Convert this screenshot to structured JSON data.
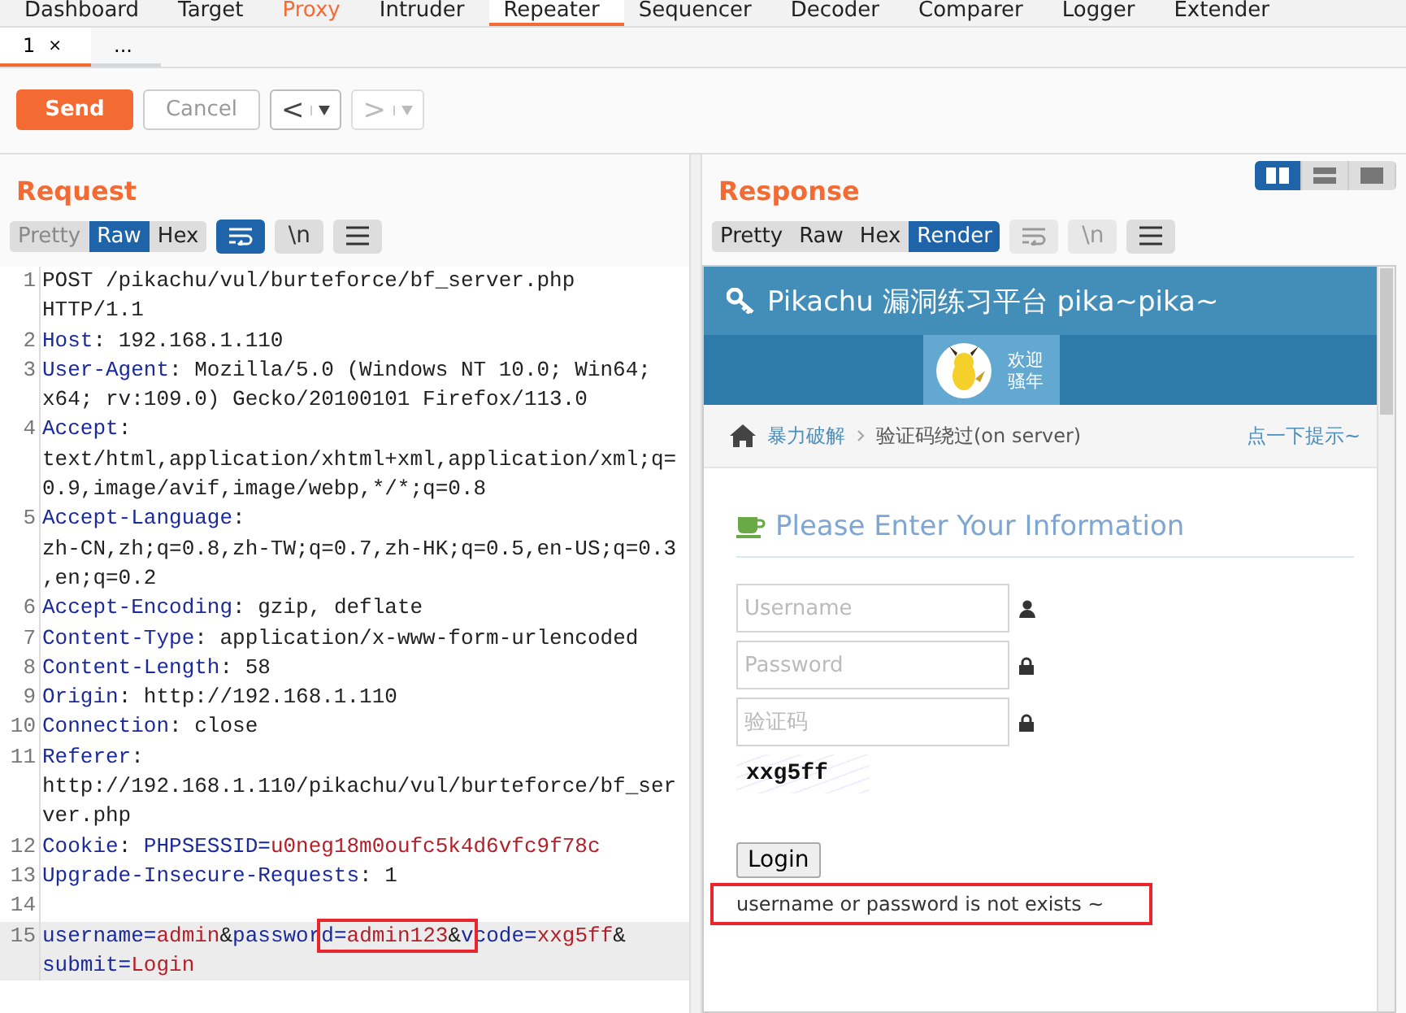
{
  "main_tabs": [
    {
      "label": "Dashboard",
      "selected": false,
      "alert": false
    },
    {
      "label": "Target",
      "selected": false,
      "alert": false
    },
    {
      "label": "Proxy",
      "selected": false,
      "alert": true
    },
    {
      "label": "Intruder",
      "selected": false,
      "alert": false
    },
    {
      "label": "Repeater",
      "selected": true,
      "alert": false
    },
    {
      "label": "Sequencer",
      "selected": false,
      "alert": false
    },
    {
      "label": "Decoder",
      "selected": false,
      "alert": false
    },
    {
      "label": "Comparer",
      "selected": false,
      "alert": false
    },
    {
      "label": "Logger",
      "selected": false,
      "alert": false
    },
    {
      "label": "Extender",
      "selected": false,
      "alert": false
    }
  ],
  "sub_tabs": [
    {
      "label": "1",
      "close": "×",
      "selected": true
    },
    {
      "label": "...",
      "selected": false
    }
  ],
  "toolbar": {
    "send": "Send",
    "cancel": {
      "label": "Cancel",
      "disabled": true
    },
    "back": {
      "label": "<",
      "disabled": false
    },
    "forward": {
      "label": ">",
      "disabled": true
    }
  },
  "layout_buttons": [
    {
      "kind": "columns",
      "selected": true
    },
    {
      "kind": "rows",
      "selected": false
    },
    {
      "kind": "single",
      "selected": false
    }
  ],
  "request": {
    "title": "Request",
    "views": [
      {
        "label": "Pretty",
        "selected": false,
        "disabled": true
      },
      {
        "label": "Raw",
        "selected": true,
        "disabled": false
      },
      {
        "label": "Hex",
        "selected": false,
        "disabled": false
      }
    ],
    "tools": [
      {
        "kind": "wrap",
        "on": true,
        "disabled": false
      },
      {
        "kind": "text",
        "label": "\\n",
        "on": false,
        "disabled": false
      },
      {
        "kind": "menu",
        "on": false,
        "disabled": false
      }
    ],
    "lines": [
      {
        "number": "1",
        "highlighted": false,
        "rows": [
          [
            {
              "kind": "plain",
              "text": "POST /pikachu/vul/burteforce/bf_server.php"
            }
          ],
          [
            {
              "kind": "plain",
              "text": "HTTP/1.1"
            }
          ]
        ]
      },
      {
        "number": "2",
        "highlighted": false,
        "rows": [
          [
            {
              "kind": "name",
              "text": "Host"
            },
            {
              "kind": "plain",
              "text": ": 192.168.1.110"
            }
          ]
        ]
      },
      {
        "number": "3",
        "highlighted": false,
        "rows": [
          [
            {
              "kind": "name",
              "text": "User-Agent"
            },
            {
              "kind": "plain",
              "text": ": Mozilla/5.0 (Windows NT 10.0; Win64;"
            }
          ],
          [
            {
              "kind": "plain",
              "text": "x64; rv:109.0) Gecko/20100101 Firefox/113.0"
            }
          ]
        ]
      },
      {
        "number": "4",
        "highlighted": false,
        "rows": [
          [
            {
              "kind": "name",
              "text": "Accept"
            },
            {
              "kind": "plain",
              "text": ":"
            }
          ],
          [
            {
              "kind": "plain",
              "text": "text/html,application/xhtml+xml,application/xml;q="
            }
          ],
          [
            {
              "kind": "plain",
              "text": "0.9,image/avif,image/webp,*/*;q=0.8"
            }
          ]
        ]
      },
      {
        "number": "5",
        "highlighted": false,
        "rows": [
          [
            {
              "kind": "name",
              "text": "Accept-Language"
            },
            {
              "kind": "plain",
              "text": ":"
            }
          ],
          [
            {
              "kind": "plain",
              "text": "zh-CN,zh;q=0.8,zh-TW;q=0.7,zh-HK;q=0.5,en-US;q=0.3"
            }
          ],
          [
            {
              "kind": "plain",
              "text": ",en;q=0.2"
            }
          ]
        ]
      },
      {
        "number": "6",
        "highlighted": false,
        "rows": [
          [
            {
              "kind": "name",
              "text": "Accept-Encoding"
            },
            {
              "kind": "plain",
              "text": ": gzip, deflate"
            }
          ]
        ]
      },
      {
        "number": "7",
        "highlighted": false,
        "rows": [
          [
            {
              "kind": "name",
              "text": "Content-Type"
            },
            {
              "kind": "plain",
              "text": ": application/x-www-form-urlencoded"
            }
          ]
        ]
      },
      {
        "number": "8",
        "highlighted": false,
        "rows": [
          [
            {
              "kind": "name",
              "text": "Content-Length"
            },
            {
              "kind": "plain",
              "text": ": 58"
            }
          ]
        ]
      },
      {
        "number": "9",
        "highlighted": false,
        "rows": [
          [
            {
              "kind": "name",
              "text": "Origin"
            },
            {
              "kind": "plain",
              "text": ": http://192.168.1.110"
            }
          ]
        ]
      },
      {
        "number": "10",
        "highlighted": false,
        "rows": [
          [
            {
              "kind": "name",
              "text": "Connection"
            },
            {
              "kind": "plain",
              "text": ": close"
            }
          ]
        ]
      },
      {
        "number": "11",
        "highlighted": false,
        "rows": [
          [
            {
              "kind": "name",
              "text": "Referer"
            },
            {
              "kind": "plain",
              "text": ":"
            }
          ],
          [
            {
              "kind": "plain",
              "text": "http://192.168.1.110/pikachu/vul/burteforce/bf_ser"
            }
          ],
          [
            {
              "kind": "plain",
              "text": "ver.php"
            }
          ]
        ]
      },
      {
        "number": "12",
        "highlighted": false,
        "rows": [
          [
            {
              "kind": "name",
              "text": "Cookie"
            },
            {
              "kind": "plain",
              "text": ": "
            },
            {
              "kind": "name",
              "text": "PHPSESSID="
            },
            {
              "kind": "value",
              "text": "u0neg18m0oufc5k4d6vfc9f78c"
            }
          ]
        ]
      },
      {
        "number": "13",
        "highlighted": false,
        "rows": [
          [
            {
              "kind": "name",
              "text": "Upgrade-Insecure-Requests"
            },
            {
              "kind": "plain",
              "text": ": 1"
            }
          ]
        ]
      },
      {
        "number": "14",
        "highlighted": false,
        "rows": [
          []
        ]
      },
      {
        "number": "15",
        "highlighted": true,
        "rows": [
          [
            {
              "kind": "name",
              "text": "username="
            },
            {
              "kind": "value",
              "text": "admin"
            },
            {
              "kind": "plain",
              "text": "&"
            },
            {
              "kind": "name",
              "text": "passwor"
            },
            {
              "kind": "name",
              "text": "d=",
              "boxed": true
            },
            {
              "kind": "value",
              "text": "admin123",
              "boxed": true
            },
            {
              "kind": "plain",
              "text": "&",
              "boxed": true
            },
            {
              "kind": "name",
              "text": "v",
              "boxed": true
            },
            {
              "kind": "name",
              "text": "code="
            },
            {
              "kind": "value",
              "text": "xxg5ff"
            },
            {
              "kind": "plain",
              "text": "&"
            }
          ],
          [
            {
              "kind": "name",
              "text": "submit="
            },
            {
              "kind": "value",
              "text": "Login"
            }
          ]
        ]
      }
    ]
  },
  "response": {
    "title": "Response",
    "views": [
      {
        "label": "Pretty",
        "selected": false,
        "disabled": false
      },
      {
        "label": "Raw",
        "selected": false,
        "disabled": false
      },
      {
        "label": "Hex",
        "selected": false,
        "disabled": false
      },
      {
        "label": "Render",
        "selected": true,
        "disabled": false
      }
    ],
    "tools": [
      {
        "kind": "wrap",
        "on": false,
        "disabled": true
      },
      {
        "kind": "text",
        "label": "\\n",
        "on": false,
        "disabled": true
      },
      {
        "kind": "menu",
        "on": false,
        "disabled": false
      }
    ],
    "render": {
      "site_title": "Pikachu 漏洞练习平台 pika~pika~",
      "welcome": [
        "欢迎",
        "骚年"
      ],
      "breadcrumb": {
        "section": "暴力破解",
        "page": "验证码绕过(on server)",
        "hint": "点一下提示~"
      },
      "form_title": "Please Enter Your Information",
      "fields": [
        {
          "placeholder": "Username",
          "kind": "user"
        },
        {
          "placeholder": "Password",
          "kind": "lock"
        },
        {
          "placeholder": "验证码",
          "kind": "lock"
        }
      ],
      "captcha": "xxg5ff",
      "login": "Login",
      "message": "username or password is not exists ~"
    }
  }
}
